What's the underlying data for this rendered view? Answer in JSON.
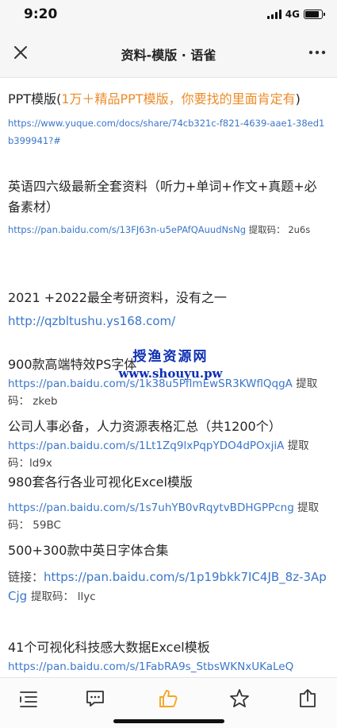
{
  "status": {
    "time": "9:20",
    "network": "4G"
  },
  "nav": {
    "title": "资料-模版 · 语雀",
    "close_icon": "close-icon",
    "more_icon": "more-icon"
  },
  "items": [
    {
      "title": "PPT模版(",
      "title_highlight": "1万＋精品PPT模版，你要找的里面肯定有",
      "title_end": ")",
      "link": "https://www.yuque.com/docs/share/74cb321c-f821-4639-aae1-38ed1b399941?#"
    },
    {
      "title": "英语四六级最新全套资料（听力+单词+作文+真题+必备素材）",
      "link": "https://pan.baidu.com/s/13FJ63n-u5ePAfQAuudNsNg",
      "code_label": "提取码：",
      "code": "2u6s"
    },
    {
      "title": "2021 +2022最全考研资料，没有之一",
      "link": "http://qzbltushu.ys168.com/"
    },
    {
      "title": "900款高端特效PS字体",
      "link": "https://pan.baidu.com/s/1k38u5PflmEwSR3KWflQqgA",
      "code_label": "提取码：",
      "code": "zkeb"
    },
    {
      "title": "公司人事必备，人力资源表格汇总（共1200个）",
      "link": "https://pan.baidu.com/s/1Lt1Zq9lxPqpYDO4dPOxjiA",
      "code_label": "提取码：",
      "code": "ld9x"
    },
    {
      "title": "980套各行各业可视化Excel模版",
      "link": "https://pan.baidu.com/s/1s7uhYB0vRqytvBDHGPPcng",
      "code_label": "提取码：",
      "code": "59BC"
    },
    {
      "title": "500+300款中英日字体合集",
      "link_label": "链接：",
      "link": "https://pan.baidu.com/s/1p19bkk7IC4JB_8z-3ApCjg",
      "code_label": "提取码：",
      "code": "llyc"
    },
    {
      "title": "41个可视化科技感大数据Excel模板",
      "link": "https://pan.baidu.com/s/1FabRA9s_StbsWKNxUKaLeQ"
    }
  ],
  "watermark": {
    "line1": "授渔资源网",
    "line2": "www.shouyu.pw"
  },
  "bottom_bar": {
    "icons": [
      "outline-icon",
      "comment-icon",
      "like-icon",
      "star-icon",
      "share-icon"
    ],
    "accent": "#f5a623"
  },
  "colors": {
    "link": "#3a76c9",
    "highlight": "#ec8b29",
    "watermark": "#0c2fb3"
  }
}
